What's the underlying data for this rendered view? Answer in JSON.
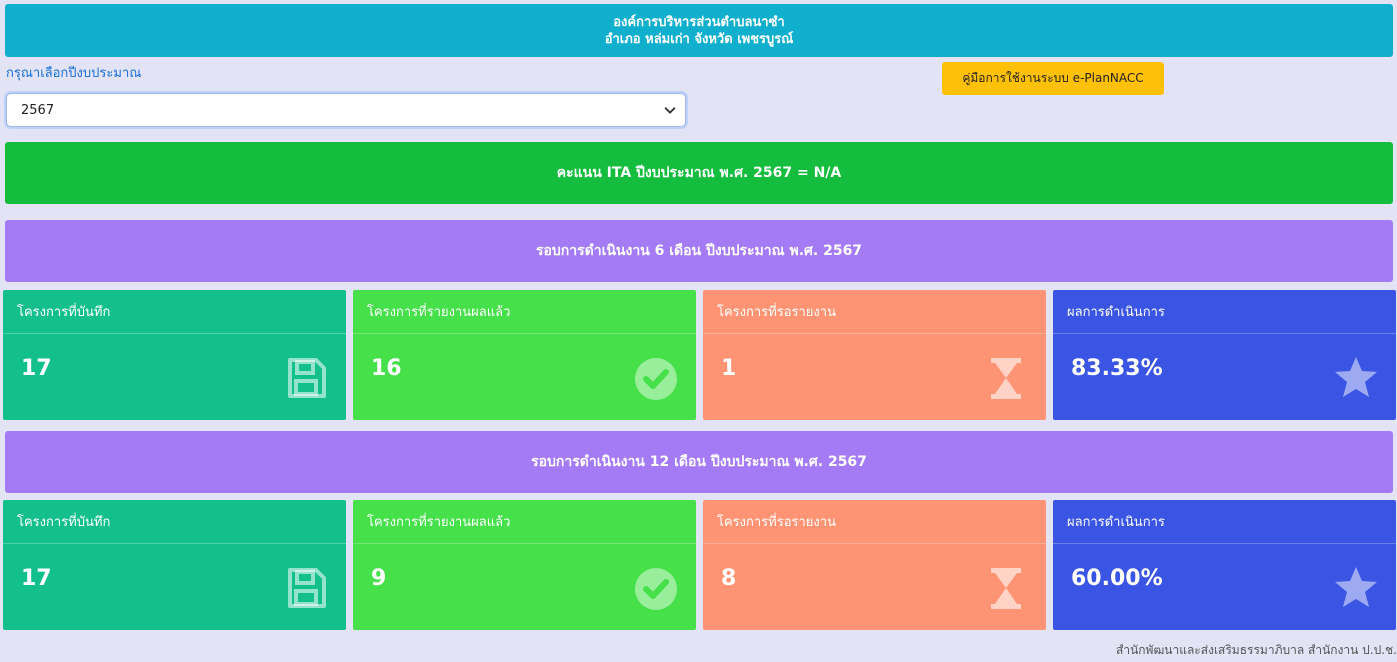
{
  "header": {
    "line1": "องค์การบริหารส่วนตำบลนาซำ",
    "line2": "อำเภอ หล่มเก่า จังหวัด เพชรบูรณ์"
  },
  "year_selector": {
    "label": "กรุณาเลือกปีงบประมาณ",
    "selected": "2567"
  },
  "manual_button": "คู่มือการใช้งานระบบ e-PlanNACC",
  "ita_score": "คะแนน ITA ปีงบประมาณ พ.ศ. 2567 = N/A",
  "rounds": [
    {
      "title": "รอบการดำเนินงาน 6 เดือน ปีงบประมาณ พ.ศ. 2567",
      "cards": [
        {
          "label": "โครงการที่บันทึก",
          "value": "17",
          "icon": "floppy-disk-icon"
        },
        {
          "label": "โครงการที่รายงานผลแล้ว",
          "value": "16",
          "icon": "check-circle-icon"
        },
        {
          "label": "โครงการที่รอรายงาน",
          "value": "1",
          "icon": "hourglass-icon"
        },
        {
          "label": "ผลการดำเนินการ",
          "value": "83.33%",
          "icon": "star-icon"
        }
      ]
    },
    {
      "title": "รอบการดำเนินงาน 12 เดือน ปีงบประมาณ พ.ศ. 2567",
      "cards": [
        {
          "label": "โครงการที่บันทึก",
          "value": "17",
          "icon": "floppy-disk-icon"
        },
        {
          "label": "โครงการที่รายงานผลแล้ว",
          "value": "9",
          "icon": "check-circle-icon"
        },
        {
          "label": "โครงการที่รอรายงาน",
          "value": "8",
          "icon": "hourglass-icon"
        },
        {
          "label": "ผลการดำเนินการ",
          "value": "60.00%",
          "icon": "star-icon"
        }
      ]
    }
  ],
  "footer": "สำนักพัฒนาและส่งเสริมธรรมาภิบาล สำนักงาน ป.ป.ช.",
  "colors": {
    "header": "#0fafcd",
    "ita": "#14bd3d",
    "round": "#a57bf5",
    "saved": "#13c08b",
    "done": "#45e04a",
    "waiting": "#ff9474",
    "result": "#3a55e3",
    "manual_button": "#ffc107"
  }
}
